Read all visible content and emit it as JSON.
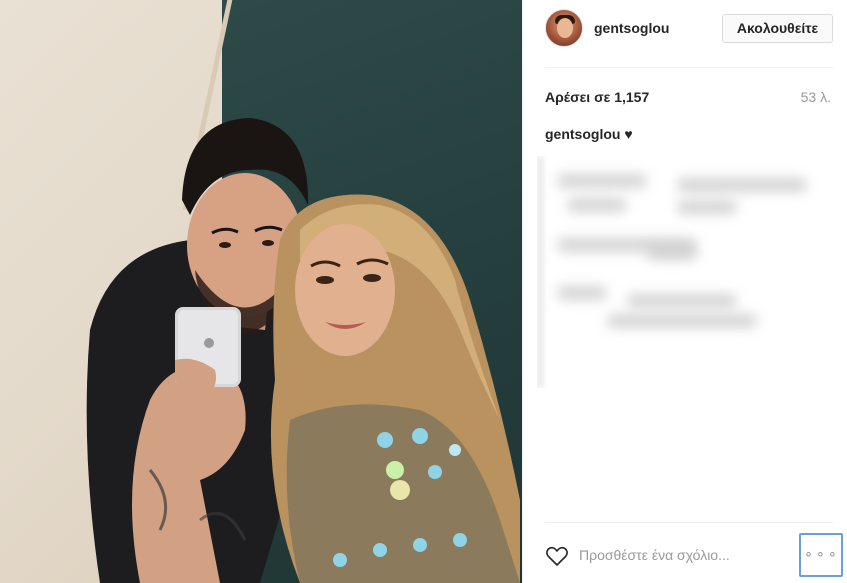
{
  "post": {
    "photo_alt": "selfie photo",
    "author": {
      "username": "gentsoglou"
    },
    "header": {
      "follow_label": "Ακολουθείτε"
    },
    "stats": {
      "likes_text": "Αρέσει σε 1,157",
      "time_ago": "53 λ."
    },
    "caption": {
      "username": "gentsoglou",
      "emoji": "♥"
    },
    "comment": {
      "placeholder": "Προσθέστε ένα σχόλιο..."
    },
    "more": {
      "label": "⚬⚬⚬"
    }
  },
  "icons": {
    "avatar": "profile-avatar",
    "heart": "heart-outline-icon",
    "more": "more-options-icon"
  },
  "colors": {
    "text_primary": "#262626",
    "text_secondary": "#999999",
    "border": "#dbdbdb",
    "focus_ring": "#6a9fd8"
  }
}
